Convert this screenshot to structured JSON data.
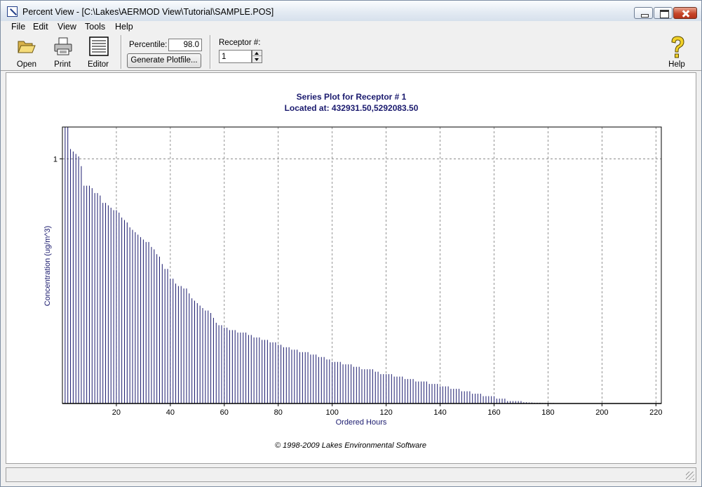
{
  "window": {
    "title": "Percent View - [C:\\Lakes\\AERMOD View\\Tutorial\\SAMPLE.POS]"
  },
  "menu": [
    "File",
    "Edit",
    "View",
    "Tools",
    "Help"
  ],
  "toolbar": {
    "open_label": "Open",
    "print_label": "Print",
    "editor_label": "Editor",
    "help_label": "Help",
    "percentile_label": "Percentile:",
    "percentile_value": "98.0",
    "generate_label": "Generate Plotfile...",
    "receptor_label": "Receptor #:",
    "receptor_value": "1"
  },
  "icons": {
    "open": "folder-open-icon",
    "print": "printer-icon",
    "editor": "editor-document-icon",
    "help": "help-question-icon"
  },
  "chart_data": {
    "type": "bar",
    "title": "Series Plot for Receptor # 1",
    "subtitle": "Located at: 432931.50,5292083.50",
    "xlabel": "Ordered Hours",
    "ylabel": "Concentration (ug/m^3)",
    "xlim": [
      0,
      222
    ],
    "ylim": [
      0,
      1.13
    ],
    "x_ticks": [
      20,
      40,
      60,
      80,
      100,
      120,
      140,
      160,
      180,
      200,
      220
    ],
    "y_ticks": [
      1
    ],
    "grid": true,
    "bar_color": "#1a1a6e",
    "footer": "© 1998-2009 Lakes Environmental Software",
    "x": [
      1,
      2,
      3,
      4,
      5,
      6,
      7,
      8,
      9,
      10,
      11,
      12,
      13,
      14,
      15,
      16,
      17,
      18,
      19,
      20,
      21,
      22,
      23,
      24,
      25,
      26,
      27,
      28,
      29,
      30,
      31,
      32,
      33,
      34,
      35,
      36,
      37,
      38,
      39,
      40,
      41,
      42,
      43,
      44,
      45,
      46,
      47,
      48,
      49,
      50,
      51,
      52,
      53,
      54,
      55,
      56,
      57,
      58,
      59,
      60,
      61,
      62,
      63,
      64,
      65,
      66,
      67,
      68,
      69,
      70,
      71,
      72,
      73,
      74,
      75,
      76,
      77,
      78,
      79,
      80,
      81,
      82,
      83,
      84,
      85,
      86,
      87,
      88,
      89,
      90,
      91,
      92,
      93,
      94,
      95,
      96,
      97,
      98,
      99,
      100,
      101,
      102,
      103,
      104,
      105,
      106,
      107,
      108,
      109,
      110,
      111,
      112,
      113,
      114,
      115,
      116,
      117,
      118,
      119,
      120,
      121,
      122,
      123,
      124,
      125,
      126,
      127,
      128,
      129,
      130,
      131,
      132,
      133,
      134,
      135,
      136,
      137,
      138,
      139,
      140,
      141,
      142,
      143,
      144,
      145,
      146,
      147,
      148,
      149,
      150,
      151,
      152,
      153,
      154,
      155,
      156,
      157,
      158,
      159,
      160,
      161,
      162,
      163,
      164,
      165,
      166,
      167,
      168,
      169,
      170,
      171,
      172,
      173,
      174,
      175,
      176,
      177,
      178,
      179,
      180,
      181,
      182,
      183,
      184,
      185,
      186,
      187,
      188,
      189,
      190,
      191,
      192,
      193,
      194,
      195,
      196,
      197,
      198,
      199,
      200,
      201,
      202,
      203,
      204,
      205,
      206,
      207,
      208,
      209,
      210,
      211,
      212,
      213,
      214,
      215,
      216,
      217,
      218
    ],
    "values": [
      1.13,
      1.13,
      1.04,
      1.03,
      1.02,
      1.01,
      0.97,
      0.89,
      0.89,
      0.89,
      0.88,
      0.86,
      0.86,
      0.85,
      0.82,
      0.82,
      0.81,
      0.8,
      0.79,
      0.79,
      0.78,
      0.76,
      0.75,
      0.74,
      0.72,
      0.71,
      0.7,
      0.69,
      0.68,
      0.67,
      0.66,
      0.66,
      0.64,
      0.63,
      0.61,
      0.6,
      0.57,
      0.55,
      0.55,
      0.51,
      0.51,
      0.49,
      0.48,
      0.48,
      0.47,
      0.47,
      0.45,
      0.43,
      0.42,
      0.41,
      0.4,
      0.39,
      0.38,
      0.38,
      0.37,
      0.35,
      0.33,
      0.32,
      0.32,
      0.31,
      0.31,
      0.3,
      0.3,
      0.3,
      0.29,
      0.29,
      0.29,
      0.29,
      0.28,
      0.28,
      0.27,
      0.27,
      0.27,
      0.26,
      0.26,
      0.26,
      0.25,
      0.25,
      0.25,
      0.24,
      0.24,
      0.23,
      0.23,
      0.23,
      0.22,
      0.22,
      0.22,
      0.21,
      0.21,
      0.21,
      0.21,
      0.2,
      0.2,
      0.2,
      0.19,
      0.19,
      0.19,
      0.18,
      0.18,
      0.17,
      0.17,
      0.17,
      0.17,
      0.16,
      0.16,
      0.16,
      0.16,
      0.15,
      0.15,
      0.15,
      0.14,
      0.14,
      0.14,
      0.14,
      0.14,
      0.13,
      0.13,
      0.12,
      0.12,
      0.12,
      0.12,
      0.12,
      0.11,
      0.11,
      0.11,
      0.11,
      0.1,
      0.1,
      0.1,
      0.1,
      0.09,
      0.09,
      0.09,
      0.09,
      0.09,
      0.08,
      0.08,
      0.08,
      0.08,
      0.07,
      0.07,
      0.07,
      0.07,
      0.06,
      0.06,
      0.06,
      0.06,
      0.05,
      0.05,
      0.05,
      0.05,
      0.04,
      0.04,
      0.04,
      0.04,
      0.03,
      0.03,
      0.03,
      0.03,
      0.03,
      0.02,
      0.02,
      0.02,
      0.02,
      0.01,
      0.01,
      0.01,
      0.01,
      0.01,
      0.01,
      0.005,
      0.005,
      0.004,
      0.004,
      0.003,
      0.003,
      0.003,
      0.002,
      0.002,
      0.002,
      0.002,
      0.002,
      0.001,
      0.001,
      0.001,
      0.001,
      0.001,
      0.001,
      0.001,
      0.001,
      0.001,
      0.001,
      0.001,
      0.001,
      0.001,
      0.001,
      0.001,
      0.001,
      0.001,
      0.001,
      0.001,
      0.001,
      0.001,
      0.001,
      0.001,
      0.001,
      0.001,
      0.001,
      0.001,
      0.001,
      0.001,
      0.001,
      0.001,
      0.001,
      0.001,
      0.001,
      0.001,
      0.001,
      0.001,
      0.001
    ]
  }
}
